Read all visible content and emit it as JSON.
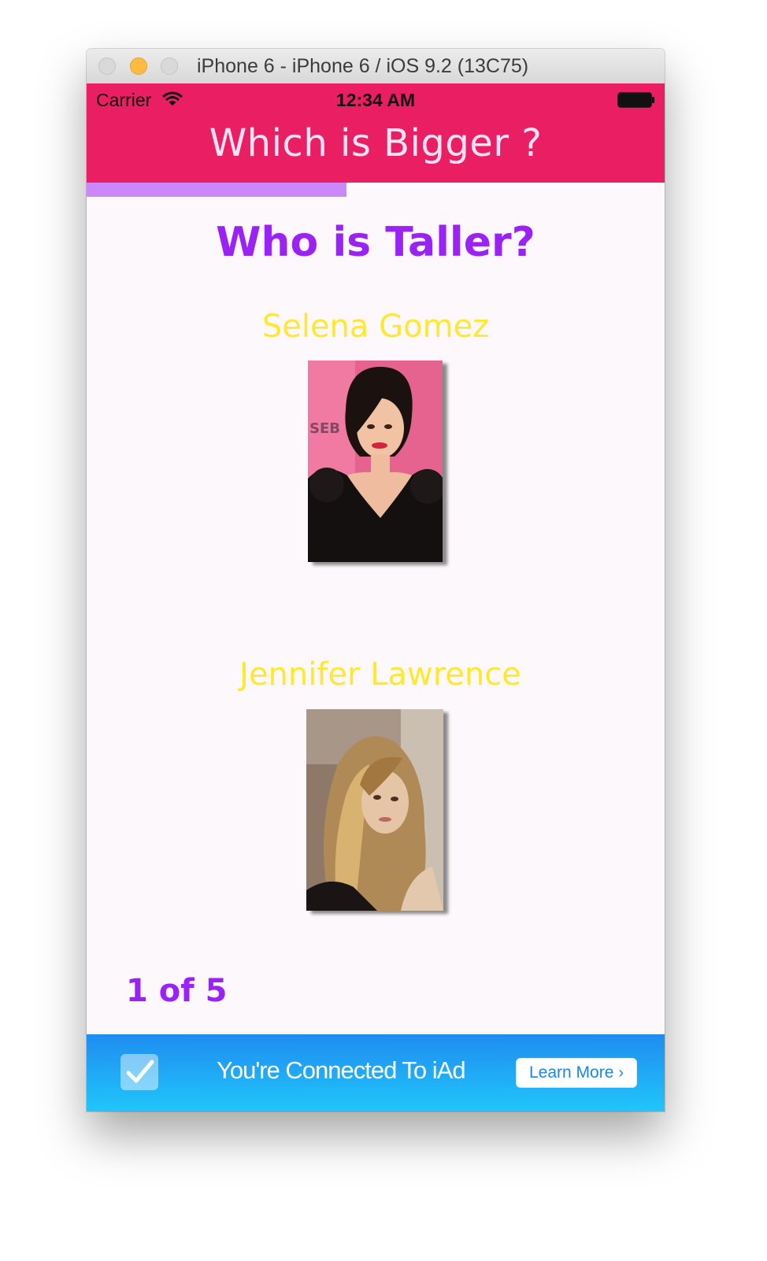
{
  "window": {
    "title": "iPhone 6 - iPhone 6 / iOS 9.2 (13C75)"
  },
  "status_bar": {
    "carrier": "Carrier",
    "time": "12:34 AM",
    "icons": [
      "wifi-icon",
      "battery-icon"
    ]
  },
  "app": {
    "title": "Which is Bigger ?",
    "progress": 0.45,
    "question": "Who is Taller?",
    "options": [
      {
        "name": "Selena Gomez"
      },
      {
        "name": "Jennifer Lawrence"
      }
    ],
    "counter": "1 of 5"
  },
  "ad": {
    "text": "You're Connected To iAd",
    "button_label": "Learn More",
    "icons": [
      "checkmark-icon",
      "chevron-right-icon"
    ]
  },
  "colors": {
    "nav_bar": "#e91e63",
    "progress_fill": "#cc88fa",
    "question_text": "#9b22f5",
    "name_text": "#ffe82e",
    "ad_banner": "#1f8cf0"
  }
}
